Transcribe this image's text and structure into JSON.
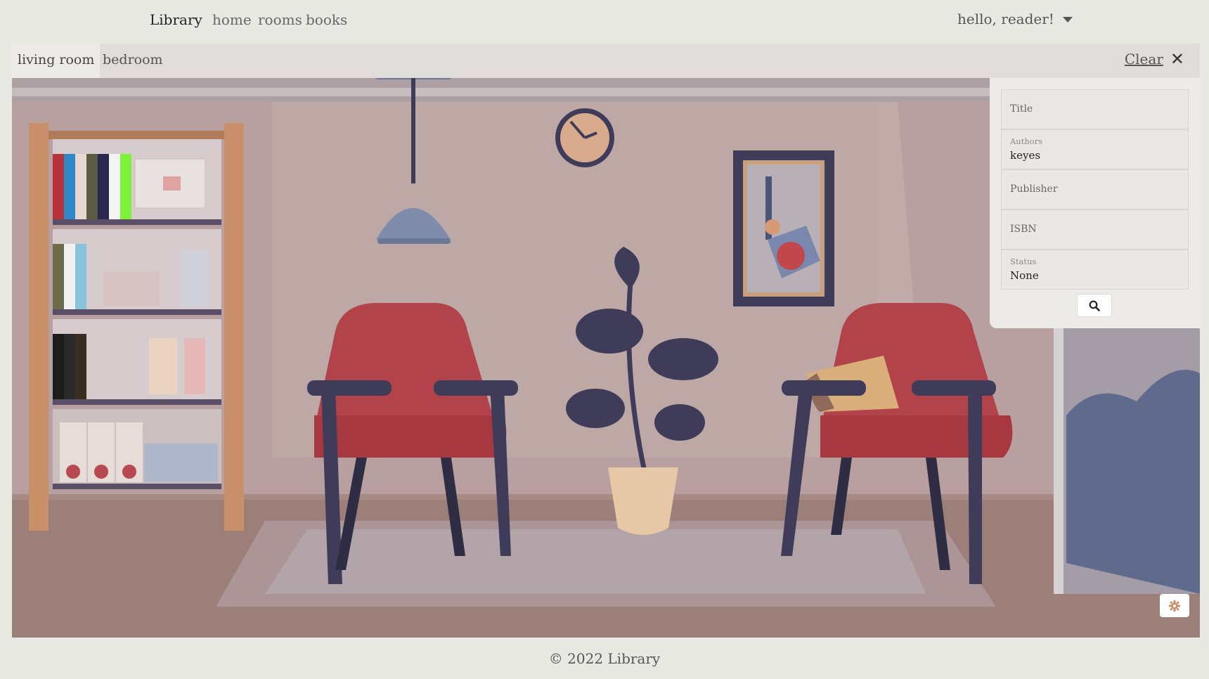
{
  "navbar": {
    "brand": "Library",
    "links": [
      "home",
      "rooms",
      "books"
    ],
    "user_greeting": "hello, reader!"
  },
  "rooms": {
    "tabs": [
      "living room",
      "bedroom"
    ],
    "active": "living room",
    "clear_label": "Clear"
  },
  "filters": {
    "title_placeholder": "Title",
    "authors_label": "Authors",
    "authors_value": "keyes",
    "publisher_placeholder": "Publisher",
    "isbn_placeholder": "ISBN",
    "status_label": "Status",
    "status_value": "None"
  },
  "icons": {
    "search": "search-icon",
    "close": "close-icon",
    "settings": "gear-icon",
    "caret": "chevron-down-icon"
  },
  "colors": {
    "wall": "#b7a09f",
    "chair": "#b2434b",
    "chair_frame": "#3f3c5a",
    "shelf_wood": "#c98f69",
    "panel_bg": "#ecebe8"
  },
  "footer": {
    "text": "© 2022 Library"
  }
}
